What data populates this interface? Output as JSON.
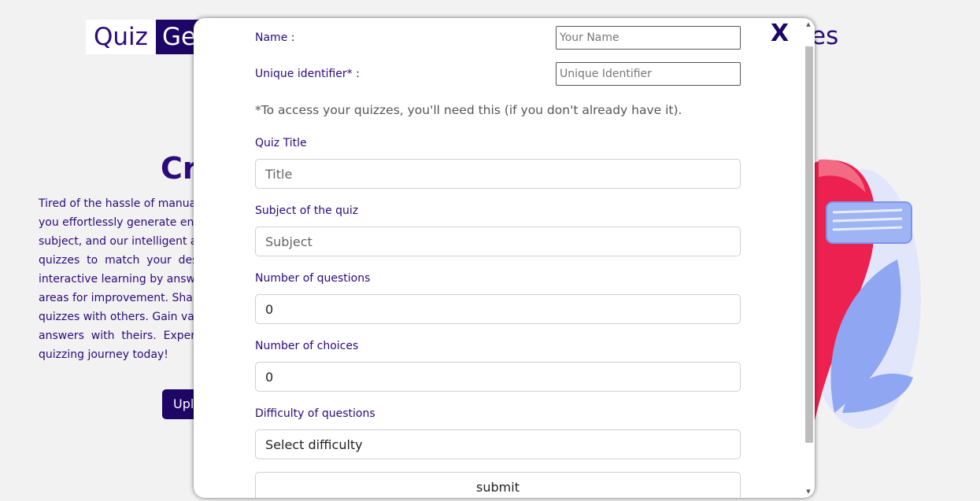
{
  "background": {
    "logo_word1": "Quiz",
    "logo_word2": "Ge",
    "nav_tail": "es",
    "heading": "Cr",
    "paragraph_lines": [
      "Tired of the hassle of manual",
      "you effortlessly generate eng",
      "subject, and our intelligent a",
      "quizzes  to  match  your  desi",
      "interactive learning by answ",
      "areas for improvement. Shar",
      "quizzes with others. Gain val",
      "answers  with  theirs.  Experic",
      "quizzing journey today!"
    ],
    "upload_label": "Uplo"
  },
  "modal": {
    "close_label": "X",
    "name_label": "Name :",
    "name_placeholder": "Your Name",
    "uid_label": "Unique identifier* :",
    "uid_placeholder": "Unique Identifier",
    "note": "*To access your quizzes, you'll need this (if you don't already have it).",
    "title_label": "Quiz Title",
    "title_placeholder": "Title",
    "subject_label": "Subject of the quiz",
    "subject_placeholder": "Subject",
    "num_questions_label": "Number of questions",
    "num_questions_value": "0",
    "num_choices_label": "Number of choices",
    "num_choices_value": "0",
    "difficulty_label": "Difficulty of questions",
    "difficulty_value": "Select difficulty",
    "submit_label": "submit"
  },
  "colors": {
    "brand": "#1e0666",
    "brand_text": "#2a0a7c",
    "illustration_red": "#ec2150",
    "illustration_blue": "#8fa6f2"
  }
}
